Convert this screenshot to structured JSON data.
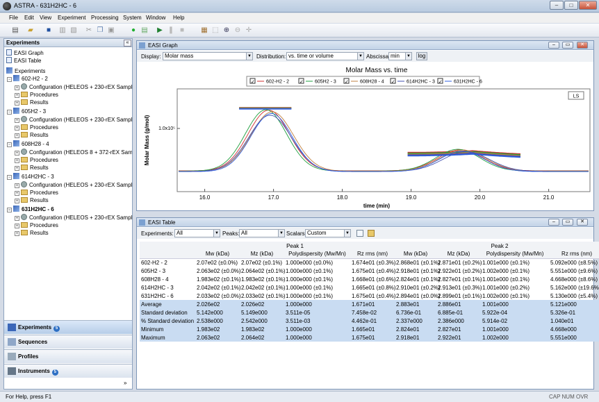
{
  "window": {
    "title": "ASTRA - 631H2HC - 6"
  },
  "menu": [
    "File",
    "Edit",
    "View",
    "Experiment",
    "Processing",
    "System",
    "Window",
    "Help"
  ],
  "left_panel": {
    "title": "Experiments",
    "views": [
      "EASI Graph",
      "EASI Table"
    ],
    "root": "Experiments",
    "experiments": [
      {
        "name": "602-H2 - 2",
        "config": "Configuration (HELEOS + 230-rEX Sample"
      },
      {
        "name": "605H2 - 3",
        "config": "Configuration (HELEOS + 230-rEX Sample"
      },
      {
        "name": "608H28 - 4",
        "config": "Configuration (HELEOS 8 + 372-rEX Samp"
      },
      {
        "name": "614H2HC - 3",
        "config": "Configuration (HELEOS + 230-rEX Sample"
      },
      {
        "name": "631H2HC - 6",
        "config": "Configuration (HELEOS + 230-rEX Sample"
      }
    ],
    "procedures_label": "Procedures",
    "results_label": "Results",
    "nav": [
      {
        "label": "Experiments",
        "badge": "5"
      },
      {
        "label": "Sequences",
        "badge": ""
      },
      {
        "label": "Profiles",
        "badge": ""
      },
      {
        "label": "Instruments",
        "badge": "5"
      }
    ]
  },
  "graph_window": {
    "title": "EASI Graph",
    "display_label": "Display:",
    "display_value": "Molar mass",
    "distribution_label": "Distribution:",
    "distribution_value": "vs. time or volume",
    "abscissa_label": "Abscissa:",
    "abscissa_value": "min",
    "log_button": "log"
  },
  "chart_data": {
    "type": "line",
    "title": "Molar Mass vs. time",
    "xlabel": "time (min)",
    "ylabel": "Molar Mass (g/mol)",
    "xlim": [
      15.6,
      21.6
    ],
    "x_ticks": [
      "16.0",
      "17.0",
      "18.0",
      "19.0",
      "20.0",
      "21.0"
    ],
    "y_tick": "1.0x10⁵",
    "ls_label": "LS",
    "series": [
      {
        "name": "602-H2 - 2",
        "color": "#d03030",
        "peak1": 16.93,
        "peak2": 19.72,
        "sigma1": 0.3,
        "sigma2": 0.33,
        "h1": 0.95,
        "h2": 0.33
      },
      {
        "name": "605H2 - 3",
        "color": "#20a040",
        "peak1": 16.89,
        "peak2": 19.68,
        "sigma1": 0.3,
        "sigma2": 0.32,
        "h1": 0.96,
        "h2": 0.34
      },
      {
        "name": "608H28 - 4",
        "color": "#c08040",
        "peak1": 16.98,
        "peak2": 19.75,
        "sigma1": 0.31,
        "sigma2": 0.34,
        "h1": 0.93,
        "h2": 0.33
      },
      {
        "name": "614H2HC - 3",
        "color": "#4050b0",
        "peak1": 16.95,
        "peak2": 19.8,
        "sigma1": 0.31,
        "sigma2": 0.34,
        "h1": 0.88,
        "h2": 0.31
      },
      {
        "name": "631H2HC - 6",
        "color": "#3060e0",
        "peak1": 16.97,
        "peak2": 19.74,
        "sigma1": 0.3,
        "sigma2": 0.33,
        "h1": 0.91,
        "h2": 0.32
      }
    ]
  },
  "table_window": {
    "title": "EASI Table",
    "experiments_label": "Experiments:",
    "experiments_value": "All",
    "peaks_label": "Peaks:",
    "peaks_value": "All",
    "scalars_label": "Scalars:",
    "scalars_value": "Custom",
    "peak_headers": [
      "Peak 1",
      "Peak 2"
    ],
    "columns": [
      "Mw (kDa)",
      "Mz (kDa)",
      "Polydispersity (Mw/Mn)",
      "Rz rms (nm)",
      "Mw (kDa)",
      "Mz (kDa)",
      "Polydispersity (Mw/Mn)",
      "Rz rms (nm)"
    ],
    "rows": [
      [
        "602-H2 - 2",
        "2.07e02 (±0.0%)",
        "2.07e02 (±0.1%)",
        "1.000e000 (±0.0%)",
        "1.674e01 (±0.3%)",
        "2.868e01 (±0.1%)",
        "2.871e01 (±0.2%)",
        "1.001e000 (±0.1%)",
        "5.092e000 (±8.5%)"
      ],
      [
        "605H2 - 3",
        "2.063e02 (±0.0%)",
        "2.064e02 (±0.1%)",
        "1.000e000 (±0.1%)",
        "1.675e01 (±0.4%)",
        "2.918e01 (±0.1%)",
        "2.922e01 (±0.2%)",
        "1.002e000 (±0.1%)",
        "5.551e000 (±9.6%)"
      ],
      [
        "608H28 - 4",
        "1.983e02 (±0.1%)",
        "1.983e02 (±0.1%)",
        "1.000e000 (±0.1%)",
        "1.668e01 (±0.6%)",
        "2.824e01 (±0.1%)",
        "2.827e01 (±0.1%)",
        "1.001e000 (±0.1%)",
        "4.668e000 (±8.6%)"
      ],
      [
        "614H2HC - 3",
        "2.042e02 (±0.1%)",
        "2.042e02 (±0.1%)",
        "1.000e000 (±0.1%)",
        "1.665e01 (±0.8%)",
        "2.910e01 (±0.2%)",
        "2.913e01 (±0.3%)",
        "1.001e000 (±0.2%)",
        "5.162e000 (±19.6%)"
      ],
      [
        "631H2HC - 6",
        "2.033e02 (±0.0%)",
        "2.033e02 (±0.1%)",
        "1.000e000 (±0.1%)",
        "1.675e01 (±0.4%)",
        "2.894e01 (±0.0%)",
        "2.899e01 (±0.1%)",
        "1.002e000 (±0.1%)",
        "5.130e000 (±5.4%)"
      ]
    ],
    "stats": [
      [
        "Average",
        "2.026e02",
        "2.026e02",
        "1.000e000",
        "1.671e01",
        "2.883e01",
        "2.886e01",
        "1.001e000",
        "5.121e000"
      ],
      [
        "Standard deviation",
        "5.142e000",
        "5.149e000",
        "3.511e-05",
        "7.458e-02",
        "6.736e-01",
        "6.885e-01",
        "5.922e-04",
        "5.326e-01"
      ],
      [
        "% Standard deviation",
        "2.538e000",
        "2.542e000",
        "3.511e-03",
        "4.462e-01",
        "2.337e000",
        "2.386e000",
        "5.914e-02",
        "1.040e01"
      ],
      [
        "Minimum",
        "1.983e02",
        "1.983e02",
        "1.000e000",
        "1.665e01",
        "2.824e01",
        "2.827e01",
        "1.001e000",
        "4.668e000"
      ],
      [
        "Maximum",
        "2.063e02",
        "2.064e02",
        "1.000e000",
        "1.675e01",
        "2.918e01",
        "2.922e01",
        "1.002e000",
        "5.551e000"
      ]
    ]
  },
  "status": {
    "left": "For Help, press F1",
    "right": "CAP  NUM  OVR"
  }
}
